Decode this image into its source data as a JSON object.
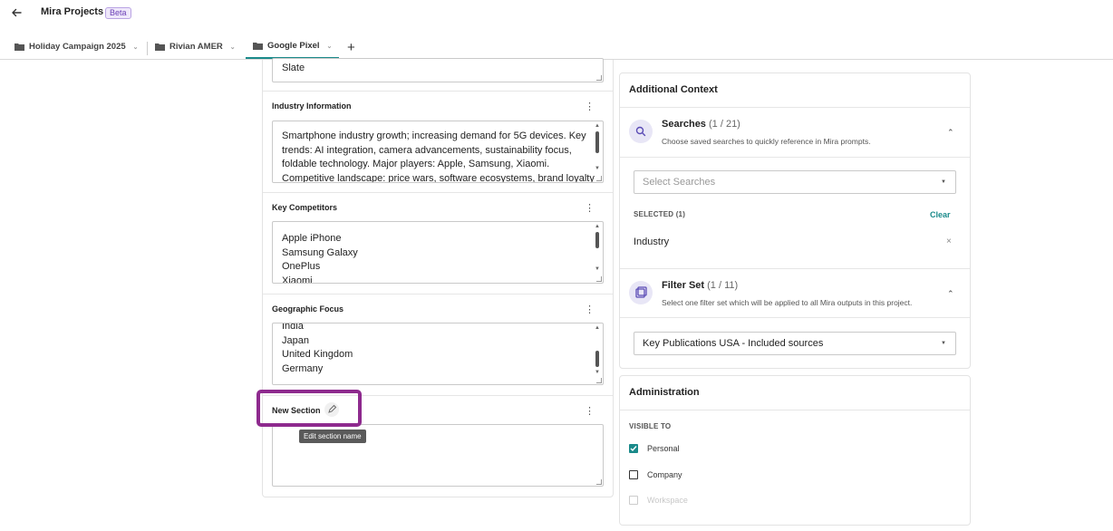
{
  "header": {
    "title": "Mira Projects",
    "badge": "Beta"
  },
  "tabs": [
    {
      "label": "Holiday Campaign 2025"
    },
    {
      "label": "Rivian AMER"
    },
    {
      "label": "Google Pixel"
    }
  ],
  "sections": {
    "top_partial": {
      "lines": [
        "Slate"
      ]
    },
    "industry": {
      "title": "Industry Information",
      "lines": [
        "Smartphone industry growth; increasing demand for 5G devices. Key",
        "trends: AI integration, camera advancements, sustainability focus,",
        "foldable technology. Major players: Apple, Samsung, Xiaomi.",
        "Competitive landscape: price wars, software ecosystems, brand loyalty"
      ]
    },
    "competitors": {
      "title": "Key Competitors",
      "lines": [
        "Apple iPhone",
        "Samsung Galaxy",
        "OnePlus",
        "Xiaomi"
      ]
    },
    "geo": {
      "title": "Geographic Focus",
      "lines": [
        "India",
        "Japan",
        "United Kingdom",
        "Germany"
      ]
    },
    "new_section": {
      "title": "New Section",
      "tooltip": "Edit section name",
      "lines": []
    }
  },
  "additional_context": {
    "title": "Additional Context",
    "searches": {
      "title": "Searches",
      "count": "(1 / 21)",
      "description": "Choose saved searches to quickly reference in Mira prompts.",
      "placeholder": "Select Searches",
      "selected_label": "SELECTED (1)",
      "clear_label": "Clear",
      "selected_items": [
        "Industry"
      ]
    },
    "filter_set": {
      "title": "Filter Set",
      "count": "(1 / 11)",
      "description": "Select one filter set which will be applied to all Mira outputs in this project.",
      "value": "Key Publications USA - Included sources"
    }
  },
  "administration": {
    "title": "Administration",
    "visible_to_label": "VISIBLE TO",
    "options": [
      {
        "label": "Personal",
        "checked": true,
        "disabled": false
      },
      {
        "label": "Company",
        "checked": false,
        "disabled": false
      },
      {
        "label": "Workspace",
        "checked": false,
        "disabled": true
      }
    ]
  },
  "colors": {
    "accent": "#1a8a8a",
    "highlight": "#8e2a8e",
    "icon_bg": "#e8e6f6",
    "icon_fg": "#5a4bb5"
  }
}
